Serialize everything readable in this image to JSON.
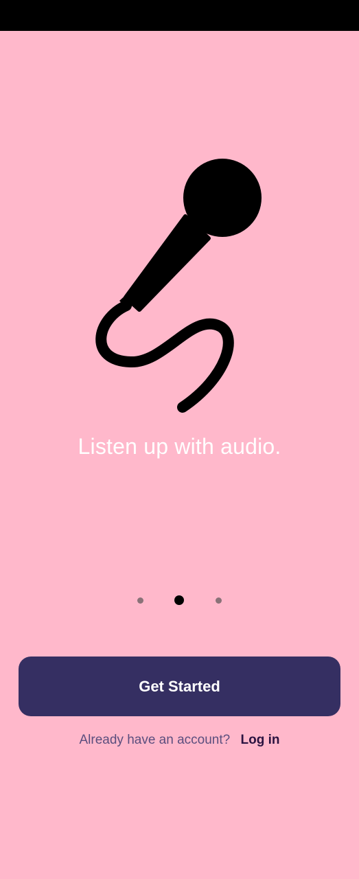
{
  "status_bar": {
    "color": "#000000"
  },
  "onboarding": {
    "illustration_icon": "microphone-icon",
    "tagline": "Listen up with audio.",
    "pager": {
      "total": 3,
      "active_index": 1
    }
  },
  "actions": {
    "get_started_label": "Get Started",
    "login_prompt": "Already have an account?",
    "login_link": "Log in"
  },
  "colors": {
    "background": "#FFB8CB",
    "primary_button": "#352F62",
    "tagline_text": "#FFFFFF",
    "active_dot": "#000000",
    "inactive_dot": "#8A7278"
  }
}
